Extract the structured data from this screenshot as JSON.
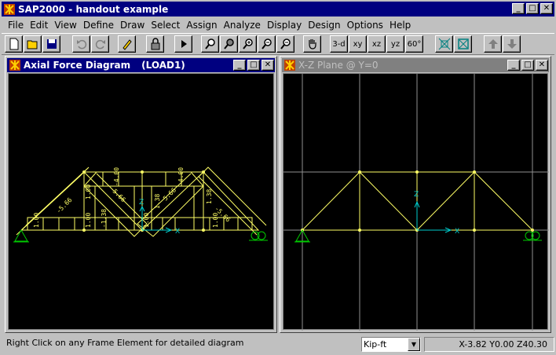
{
  "app": {
    "title": "SAP2000 - handout example",
    "window_buttons": [
      "_",
      "□",
      "✕"
    ]
  },
  "menu": [
    "File",
    "Edit",
    "View",
    "Define",
    "Draw",
    "Select",
    "Assign",
    "Analyze",
    "Display",
    "Design",
    "Options",
    "Help"
  ],
  "toolbar": {
    "view_3d": "3-d",
    "view_xy": "xy",
    "view_xz": "xz",
    "view_yz": "yz",
    "view_rotate": "60°"
  },
  "left_window": {
    "title": "Axial Force Diagram",
    "load_case": "(LOAD1)"
  },
  "right_window": {
    "title": "X-Z Plane @ Y=0"
  },
  "labels": {
    "axis_x": "X",
    "axis_z": "Z"
  },
  "member_forces": [
    "-4.00",
    "-4.00",
    "1.00",
    "1.00",
    "1.00",
    "1.00",
    "1.00",
    "-5.66",
    "5.66",
    "-5.66",
    "5.66",
    "1.38",
    "1.38",
    "-1.38"
  ],
  "statusbar": {
    "message": "Right Click on any Frame Element for detailed diagram",
    "units": "Kip-ft",
    "coordinates": "X-3.82  Y0.00  Z40.30"
  },
  "colors": {
    "titlebar_active": "#000080",
    "titlebar_inactive": "#808080",
    "frame": "#ffff66",
    "support": "#00cc00",
    "axes": "#00cccc",
    "grid": "#909090",
    "canvas": "#000000"
  }
}
